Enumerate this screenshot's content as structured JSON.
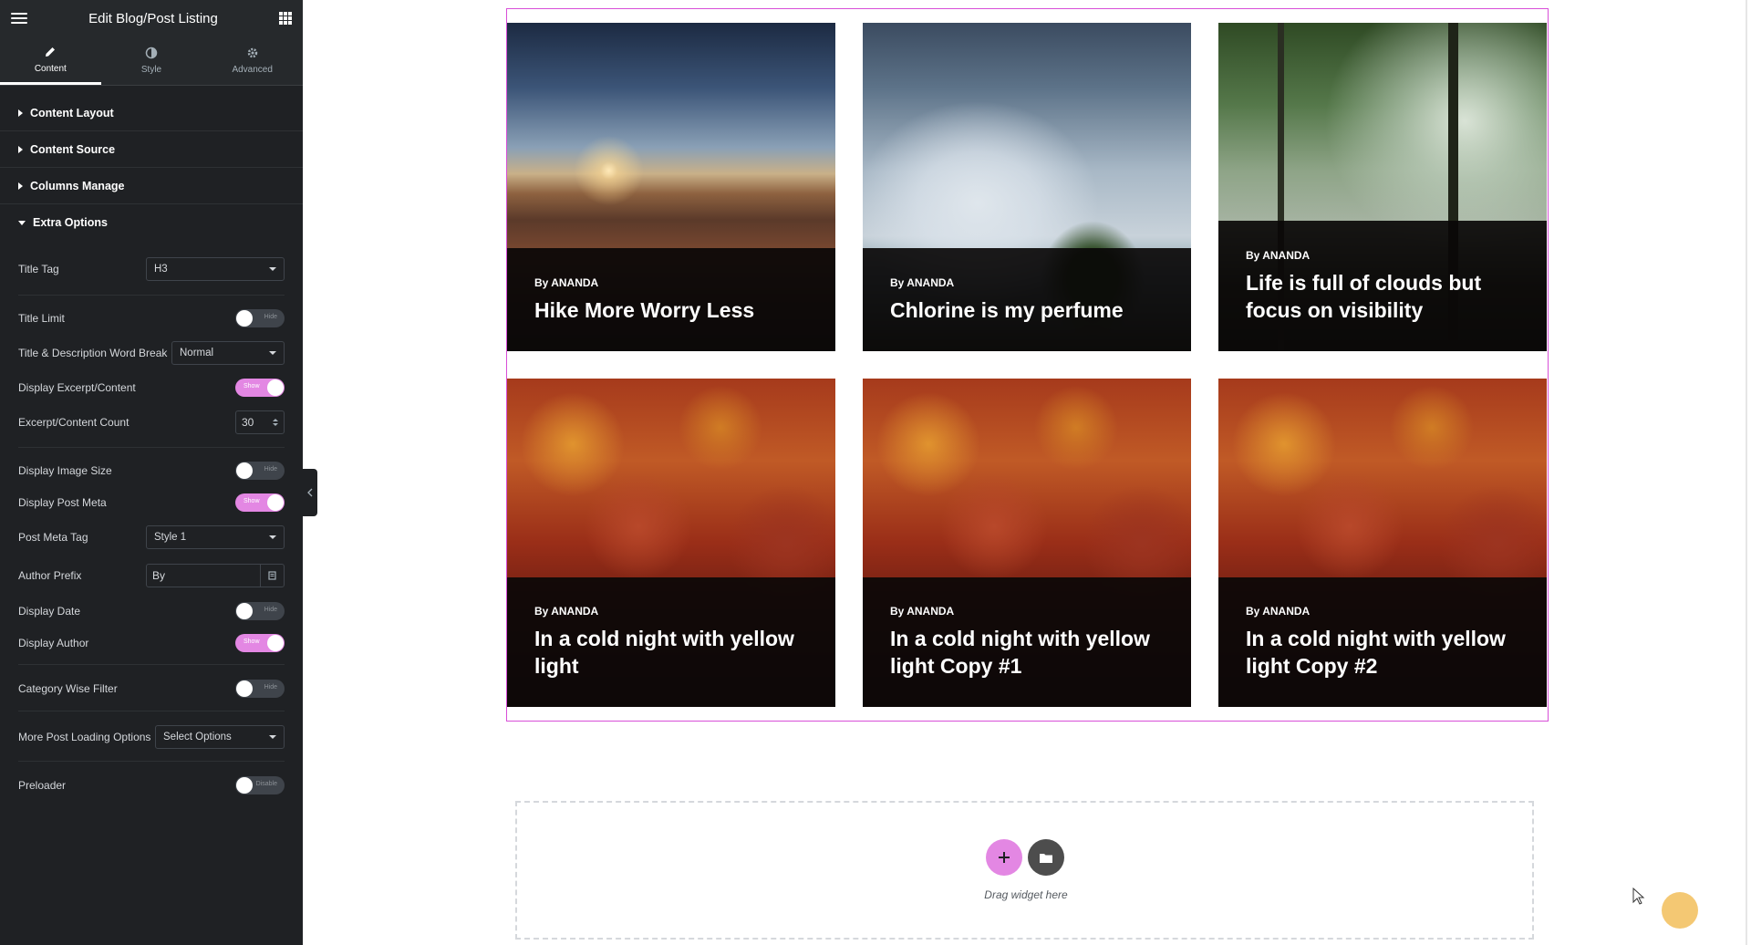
{
  "panel": {
    "title": "Edit Blog/Post Listing",
    "tabs": [
      {
        "label": "Content",
        "icon": "pencil-icon"
      },
      {
        "label": "Style",
        "icon": "contrast-icon"
      },
      {
        "label": "Advanced",
        "icon": "gear-icon"
      }
    ],
    "sections": [
      {
        "label": "Content Layout",
        "expanded": false
      },
      {
        "label": "Content Source",
        "expanded": false
      },
      {
        "label": "Columns Manage",
        "expanded": false
      },
      {
        "label": "Extra Options",
        "expanded": true
      }
    ],
    "controls": {
      "title_tag": {
        "label": "Title Tag",
        "value": "H3"
      },
      "title_limit": {
        "label": "Title Limit",
        "state": "Hide"
      },
      "word_break": {
        "label": "Title & Description Word Break",
        "value": "Normal"
      },
      "display_excerpt": {
        "label": "Display Excerpt/Content",
        "state": "Show"
      },
      "excerpt_count": {
        "label": "Excerpt/Content Count",
        "value": "30"
      },
      "display_image_size": {
        "label": "Display Image Size",
        "state": "Hide"
      },
      "display_post_meta": {
        "label": "Display Post Meta",
        "state": "Show"
      },
      "post_meta_tag": {
        "label": "Post Meta Tag",
        "value": "Style 1"
      },
      "author_prefix": {
        "label": "Author Prefix",
        "value": "By"
      },
      "display_date": {
        "label": "Display Date",
        "state": "Hide"
      },
      "display_author": {
        "label": "Display Author",
        "state": "Show"
      },
      "category_filter": {
        "label": "Category Wise Filter",
        "state": "Hide"
      },
      "more_post_loading": {
        "label": "More Post Loading Options",
        "value": "Select Options"
      },
      "preloader": {
        "label": "Preloader",
        "state": "Disable"
      }
    }
  },
  "posts": [
    {
      "meta": "By ANANDA",
      "title": "Hike More Worry Less"
    },
    {
      "meta": "By ANANDA",
      "title": "Chlorine is my perfume"
    },
    {
      "meta": "By ANANDA",
      "title": "Life is full of clouds but focus on visibility"
    },
    {
      "meta": "By ANANDA",
      "title": "In a cold night with yellow light"
    },
    {
      "meta": "By ANANDA",
      "title": "In a cold night with yellow light Copy #1"
    },
    {
      "meta": "By ANANDA",
      "title": "In a cold night with yellow light Copy #2"
    }
  ],
  "drop_zone": {
    "text": "Drag widget here",
    "add_icon": "plus-icon",
    "template_icon": "folder-icon"
  },
  "colors": {
    "accent": "#e387e3",
    "panel_bg": "#1f2124",
    "outline": "#d84fd8",
    "help_bubble": "#f4c873"
  }
}
